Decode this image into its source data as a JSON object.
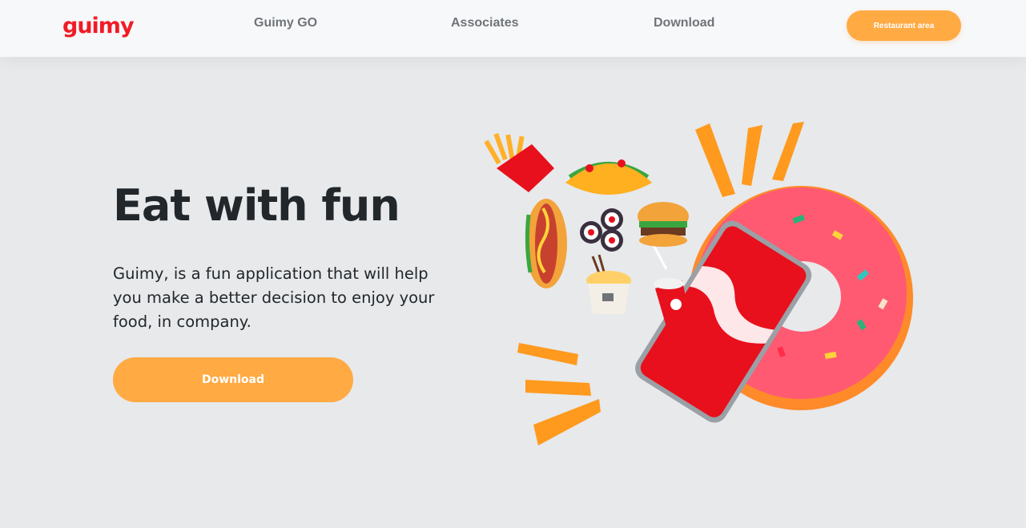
{
  "header": {
    "logo": "guimy",
    "nav": [
      "Guimy GO",
      "Associates",
      "Download"
    ],
    "cta": "Restaurant area"
  },
  "hero": {
    "title": "Eat with fun",
    "description": "Guimy, is a fun application that will help you make a better decision to enjoy your food, in company.",
    "button": "Download",
    "illustration_items": [
      "fries-icon",
      "taco-icon",
      "hotdog-icon",
      "sushi-icon",
      "burger-icon",
      "noodles-icon",
      "soda-cup-icon",
      "smartphone-icon",
      "donut-icon",
      "fry-stick-icon"
    ]
  },
  "colors": {
    "brand_red": "#f01c26",
    "accent_orange": "#ffaa43",
    "background": "#e7e9eb",
    "header_bg": "#f7f8f9",
    "text_dark": "#22272b",
    "nav_gray": "#6f7479"
  }
}
